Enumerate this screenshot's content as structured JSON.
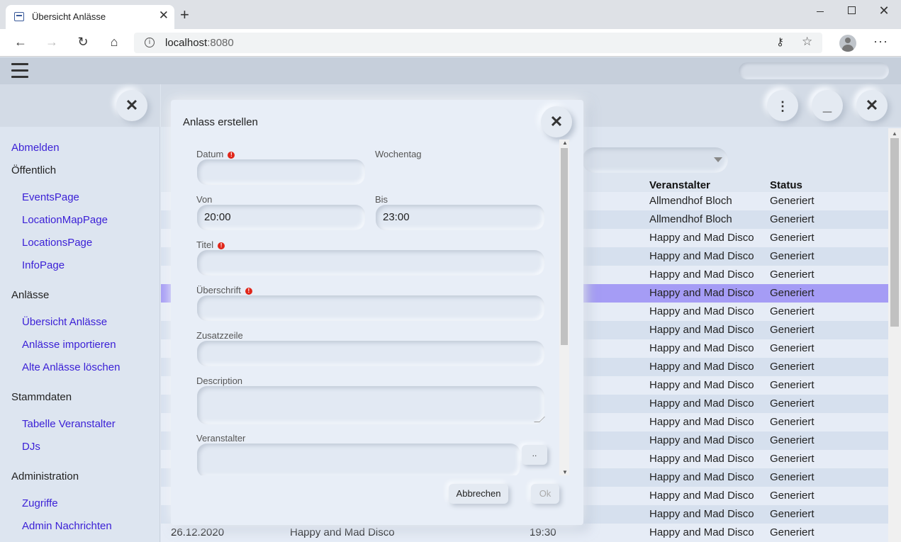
{
  "browser": {
    "tab_title": "Übersicht Anlässe",
    "url_host": "localhost",
    "url_port": ":8080",
    "icons": {
      "back": "arrow-left-icon",
      "forward": "arrow-right-icon",
      "reload": "reload-icon",
      "home": "home-icon",
      "info": "info-icon",
      "key": "key-icon",
      "favorite": "star-icon",
      "profile": "profile-icon",
      "more": "ellipsis-icon"
    }
  },
  "sidebar": {
    "items": [
      {
        "label": "Abmelden",
        "type": "link"
      },
      {
        "label": "Öffentlich",
        "type": "heading"
      },
      {
        "label": "EventsPage",
        "type": "link"
      },
      {
        "label": "LocationMapPage",
        "type": "link"
      },
      {
        "label": "LocationsPage",
        "type": "link"
      },
      {
        "label": "InfoPage",
        "type": "link"
      },
      {
        "label": "Anlässe",
        "type": "heading"
      },
      {
        "label": "Übersicht Anlässe",
        "type": "link"
      },
      {
        "label": "Anlässe importieren",
        "type": "link"
      },
      {
        "label": "Alte Anlässe löschen",
        "type": "link"
      },
      {
        "label": "Stammdaten",
        "type": "heading"
      },
      {
        "label": "Tabelle Veranstalter",
        "type": "link"
      },
      {
        "label": "DJs",
        "type": "link"
      },
      {
        "label": "Administration",
        "type": "heading"
      },
      {
        "label": "Zugriffe",
        "type": "link"
      },
      {
        "label": "Admin Nachrichten",
        "type": "link"
      }
    ]
  },
  "table": {
    "columns": {
      "organizer": "Veranstalter",
      "status": "Status"
    },
    "rows": [
      {
        "organizer": "Allmendhof Bloch",
        "status": "Generiert"
      },
      {
        "organizer": "Allmendhof Bloch",
        "status": "Generiert"
      },
      {
        "organizer": "Happy and Mad Disco",
        "status": "Generiert"
      },
      {
        "organizer": "Happy and Mad Disco",
        "status": "Generiert"
      },
      {
        "organizer": "Happy and Mad Disco",
        "status": "Generiert"
      },
      {
        "organizer": "Happy and Mad Disco",
        "status": "Generiert",
        "selected": true
      },
      {
        "organizer": "Happy and Mad Disco",
        "status": "Generiert"
      },
      {
        "organizer": "Happy and Mad Disco",
        "status": "Generiert"
      },
      {
        "organizer": "Happy and Mad Disco",
        "status": "Generiert"
      },
      {
        "organizer": "Happy and Mad Disco",
        "status": "Generiert"
      },
      {
        "organizer": "Happy and Mad Disco",
        "status": "Generiert"
      },
      {
        "organizer": "Happy and Mad Disco",
        "status": "Generiert"
      },
      {
        "organizer": "Happy and Mad Disco",
        "status": "Generiert"
      },
      {
        "organizer": "Happy and Mad Disco",
        "status": "Generiert"
      },
      {
        "organizer": "Happy and Mad Disco",
        "status": "Generiert"
      },
      {
        "organizer": "Happy and Mad Disco",
        "status": "Generiert"
      },
      {
        "organizer": "Happy and Mad Disco",
        "status": "Generiert"
      },
      {
        "organizer": "Happy and Mad Disco",
        "status": "Generiert"
      },
      {
        "date": "26.12.2020",
        "title": "Happy and Mad Disco",
        "time": "19:30",
        "organizer": "Happy and Mad Disco",
        "status": "Generiert"
      }
    ]
  },
  "modal": {
    "title": "Anlass erstellen",
    "fields": {
      "datum": {
        "label": "Datum",
        "value": "",
        "required": true
      },
      "wochentag": {
        "label": "Wochentag"
      },
      "von": {
        "label": "Von",
        "value": "20:00"
      },
      "bis": {
        "label": "Bis",
        "value": "23:00"
      },
      "titel": {
        "label": "Titel",
        "value": "",
        "required": true
      },
      "ueberschrift": {
        "label": "Überschrift",
        "value": "",
        "required": true
      },
      "zusatzzeile": {
        "label": "Zusatzzeile",
        "value": ""
      },
      "description": {
        "label": "Description",
        "value": ""
      },
      "veranstalter": {
        "label": "Veranstalter",
        "value": "",
        "picker_label": ".."
      }
    },
    "cancel_label": "Abbrechen",
    "ok_label": "Ok"
  },
  "colors": {
    "link": "#3a1fd6",
    "selected_row": "#a59cf5",
    "required": "#e0261a"
  }
}
